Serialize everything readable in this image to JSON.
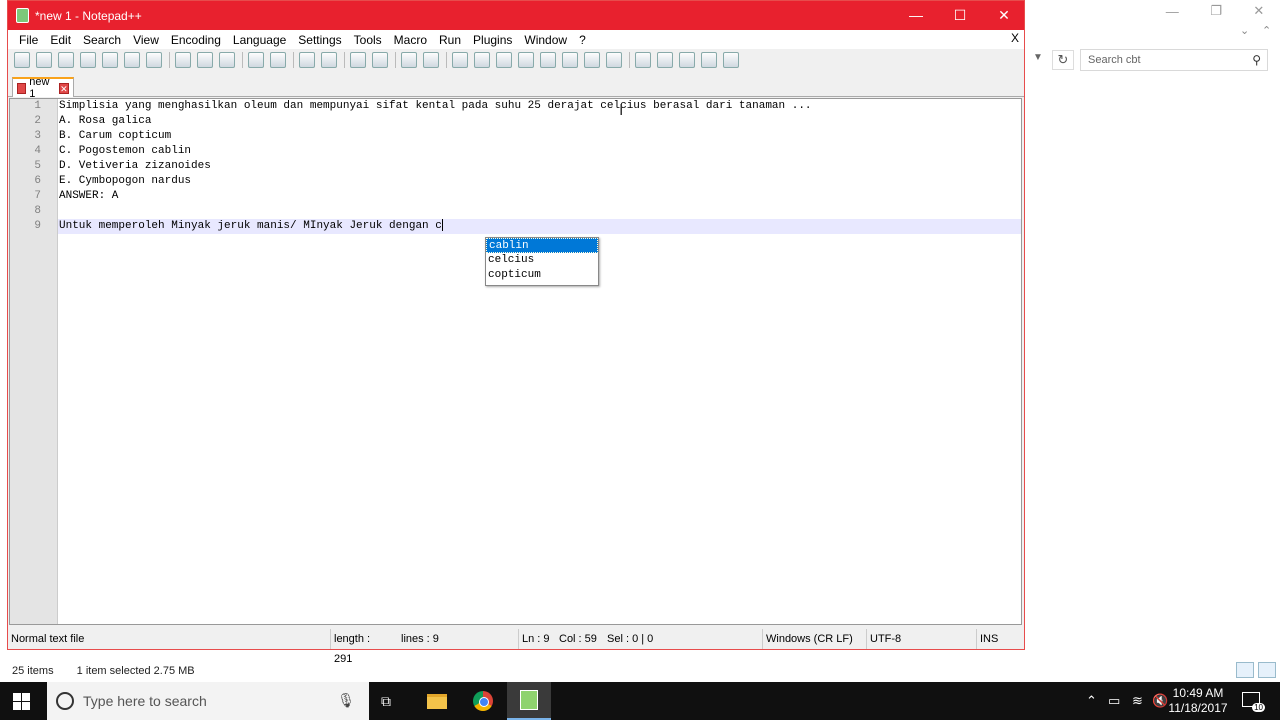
{
  "window": {
    "title": "*new 1 - Notepad++",
    "minimize": "—",
    "maximize": "☐",
    "close": "✕",
    "doc_close": "X"
  },
  "menu": [
    "File",
    "Edit",
    "Search",
    "View",
    "Encoding",
    "Language",
    "Settings",
    "Tools",
    "Macro",
    "Run",
    "Plugins",
    "Window",
    "?"
  ],
  "tab": {
    "label": "new 1",
    "close": "✕"
  },
  "editor": {
    "lines": [
      "Simplisia yang menghasilkan oleum dan mempunyai sifat kental pada suhu 25 derajat celcius berasal dari tanaman ...",
      "A. Rosa galica",
      "B. Carum copticum",
      "C. Pogostemon cablin",
      "D. Vetiveria zizanoides",
      "E. Cymbopogon nardus",
      "ANSWER: A",
      "",
      "Untuk memperoleh Minyak jeruk manis/ MInyak Jeruk dengan c"
    ],
    "line_numbers": [
      "1",
      "2",
      "3",
      "4",
      "5",
      "6",
      "7",
      "8",
      "9"
    ],
    "current_line": 9
  },
  "autocomplete": {
    "items": [
      "cablin",
      "celcius",
      "copticum"
    ],
    "selected": 0
  },
  "status": {
    "type": "Normal text file",
    "length": "length : 291",
    "lines": "lines : 9",
    "ln": "Ln : 9",
    "col": "Col : 59",
    "sel": "Sel : 0 | 0",
    "eol": "Windows (CR LF)",
    "encoding": "UTF-8",
    "mode": "INS"
  },
  "explorer": {
    "search_placeholder": "Search cbt",
    "items_count": "25 items",
    "selection": "1 item selected  2.75 MB"
  },
  "taskbar": {
    "search_placeholder": "Type here to search",
    "time": "10:49 AM",
    "date": "11/18/2017",
    "notifications": "10"
  },
  "colors": {
    "titlebar": "#e8212e",
    "taskbar": "#101010",
    "selection": "#0078d7",
    "current_line": "#e8e8ff"
  }
}
